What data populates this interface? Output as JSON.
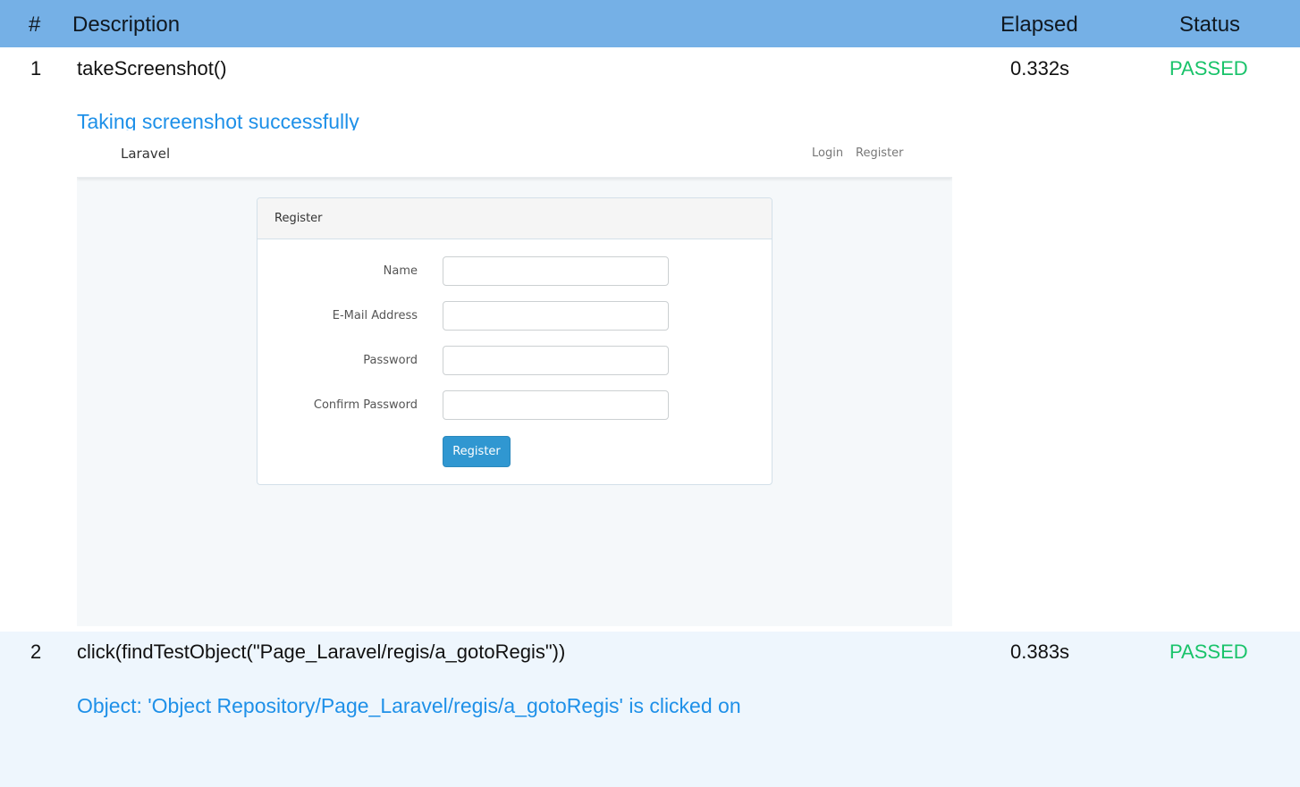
{
  "header": {
    "number": "#",
    "description": "Description",
    "elapsed": "Elapsed",
    "status": "Status"
  },
  "rows": [
    {
      "number": "1",
      "description": "takeScreenshot()",
      "elapsed": "0.332s",
      "status": "PASSED",
      "message": "Taking screenshot successfully"
    },
    {
      "number": "2",
      "description": "click(findTestObject(\"Page_Laravel/regis/a_gotoRegis\"))",
      "elapsed": "0.383s",
      "status": "PASSED",
      "message": "Object: 'Object Repository/Page_Laravel/regis/a_gotoRegis' is clicked on"
    }
  ],
  "screenshot": {
    "brand": "Laravel",
    "nav_links": [
      "Login",
      "Register"
    ],
    "panel_title": "Register",
    "fields": [
      {
        "label": "Name",
        "value": ""
      },
      {
        "label": "E-Mail Address",
        "value": ""
      },
      {
        "label": "Password",
        "value": ""
      },
      {
        "label": "Confirm Password",
        "value": ""
      }
    ],
    "submit_label": "Register"
  },
  "colors": {
    "header_bg": "#75b0e6",
    "passed": "#19c36a",
    "message": "#1e90e8",
    "row_alt_bg": "#eef6fd"
  }
}
